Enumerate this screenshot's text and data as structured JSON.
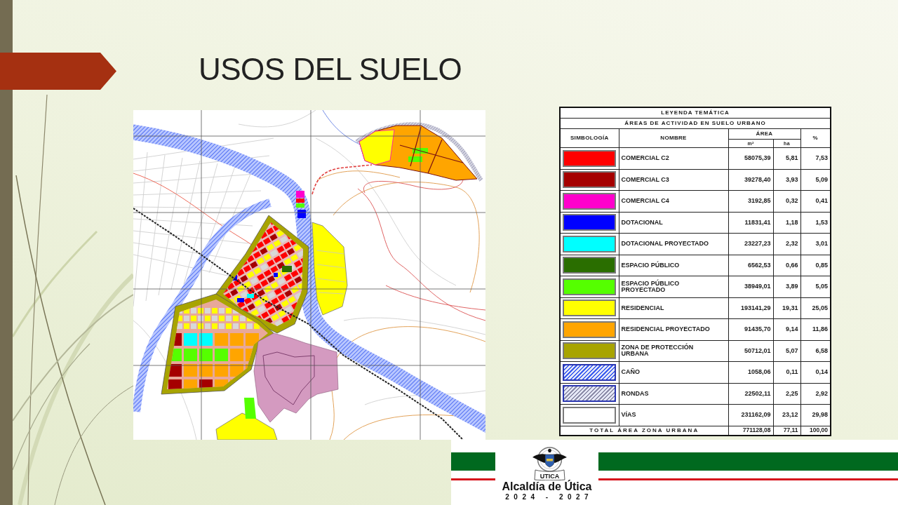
{
  "slide": {
    "title": "USOS DEL SUELO"
  },
  "legend": {
    "title": "LEYENDA TEMÁTICA",
    "subtitle": "ÁREAS DE ACTIVIDAD EN SUELO URBANO",
    "columns": {
      "symbol": "SIMBOLOGÍA",
      "name": "NOMBRE",
      "area": "ÁREA",
      "m2": "m²",
      "ha": "ha",
      "percent": "%"
    },
    "rows": [
      {
        "kind": "solid",
        "color": "#ff0000",
        "name": "COMERCIAL C2",
        "m2": "58075,39",
        "ha": "5,81",
        "percent": "7,53"
      },
      {
        "kind": "solid",
        "color": "#a50000",
        "name": "COMERCIAL C3",
        "m2": "39278,40",
        "ha": "3,93",
        "percent": "5,09"
      },
      {
        "kind": "solid",
        "color": "#ff00cc",
        "name": "COMERCIAL C4",
        "m2": "3192,85",
        "ha": "0,32",
        "percent": "0,41"
      },
      {
        "kind": "solid",
        "color": "#0000ff",
        "name": "DOTACIONAL",
        "m2": "11831,41",
        "ha": "1,18",
        "percent": "1,53"
      },
      {
        "kind": "solid",
        "color": "#00ffff",
        "name": "DOTACIONAL PROYECTADO",
        "m2": "23227,23",
        "ha": "2,32",
        "percent": "3,01"
      },
      {
        "kind": "solid",
        "color": "#2a6e00",
        "name": "ESPACIO PÚBLICO",
        "m2": "6562,53",
        "ha": "0,66",
        "percent": "0,85"
      },
      {
        "kind": "solid",
        "color": "#55ff00",
        "name": "ESPACIO PÚBLICO PROYECTADO",
        "m2": "38949,01",
        "ha": "3,89",
        "percent": "5,05"
      },
      {
        "kind": "solid",
        "color": "#ffff00",
        "name": "RESIDENCIAL",
        "m2": "193141,29",
        "ha": "19,31",
        "percent": "25,05"
      },
      {
        "kind": "solid",
        "color": "#ffa500",
        "name": "RESIDENCIAL PROYECTADO",
        "m2": "91435,70",
        "ha": "9,14",
        "percent": "11,86"
      },
      {
        "kind": "solid",
        "color": "#a8a400",
        "name": "ZONA DE PROTECCIÓN URBANA",
        "m2": "50712,01",
        "ha": "5,07",
        "percent": "6,58"
      },
      {
        "kind": "hatch",
        "color": "#3a5cf0",
        "name": "CAÑO",
        "m2": "1058,06",
        "ha": "0,11",
        "percent": "0,14"
      },
      {
        "kind": "hatch",
        "color": "#8c8ca8",
        "name": "RONDAS",
        "m2": "22502,11",
        "ha": "2,25",
        "percent": "2,92"
      },
      {
        "kind": "solid",
        "color": "#ffffff",
        "name": "VÍAS",
        "m2": "231162,09",
        "ha": "23,12",
        "percent": "29,98"
      }
    ],
    "total": {
      "label": "TOTAL ÁREA ZONA URBANA",
      "m2": "771128,08",
      "ha": "77,11",
      "percent": "100,00"
    }
  },
  "footer": {
    "emblem_label": "UTICA",
    "name": "Alcaldía de Útica",
    "years": "2024 - 2027"
  }
}
